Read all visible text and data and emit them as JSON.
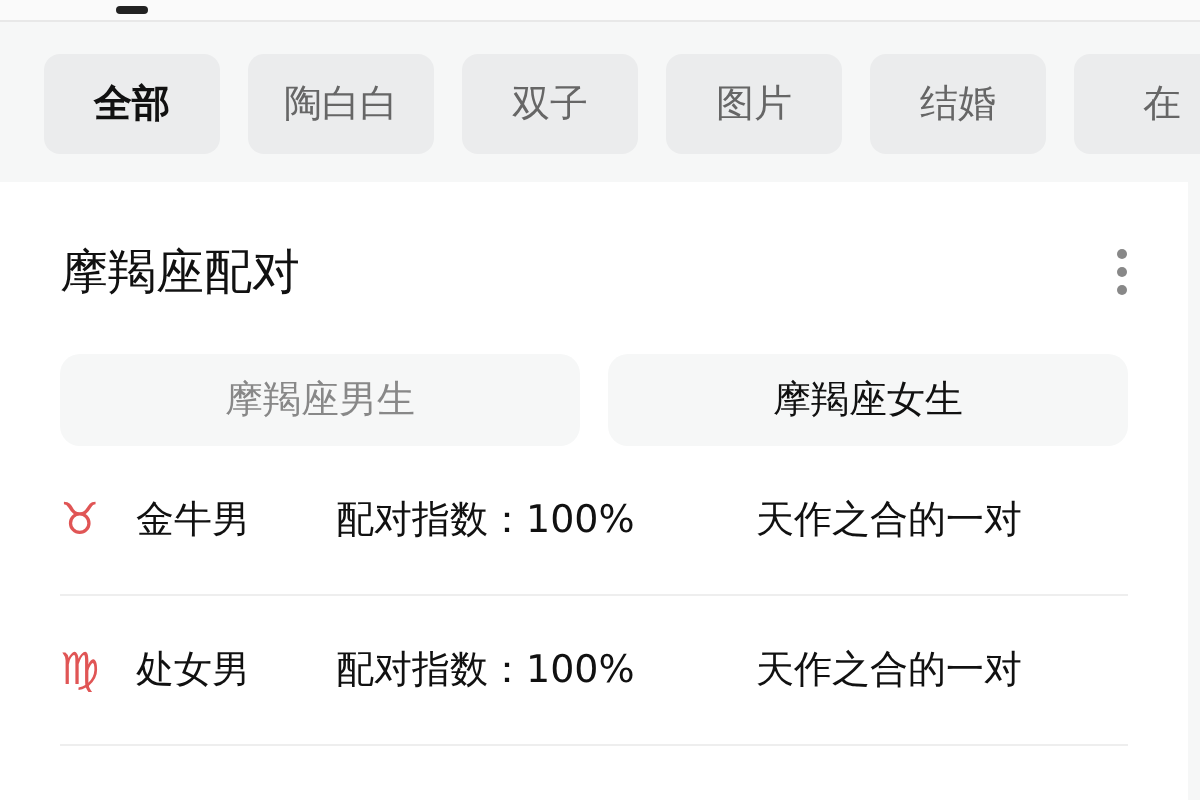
{
  "tabs": [
    {
      "label": "全部",
      "selected": true
    },
    {
      "label": "陶白白",
      "selected": false
    },
    {
      "label": "双子",
      "selected": false
    },
    {
      "label": "图片",
      "selected": false
    },
    {
      "label": "结婚",
      "selected": false
    },
    {
      "label": "在",
      "selected": false
    }
  ],
  "card": {
    "title": "摩羯座配对",
    "segments": [
      {
        "label": "摩羯座男生",
        "selected": false
      },
      {
        "label": "摩羯座女生",
        "selected": true
      }
    ],
    "rows": [
      {
        "symbol": "♉",
        "sign": "金牛男",
        "index": "配对指数：100%",
        "verdict": "天作之合的一对"
      },
      {
        "symbol": "♍",
        "sign": "处女男",
        "index": "配对指数：100%",
        "verdict": "天作之合的一对"
      }
    ]
  }
}
